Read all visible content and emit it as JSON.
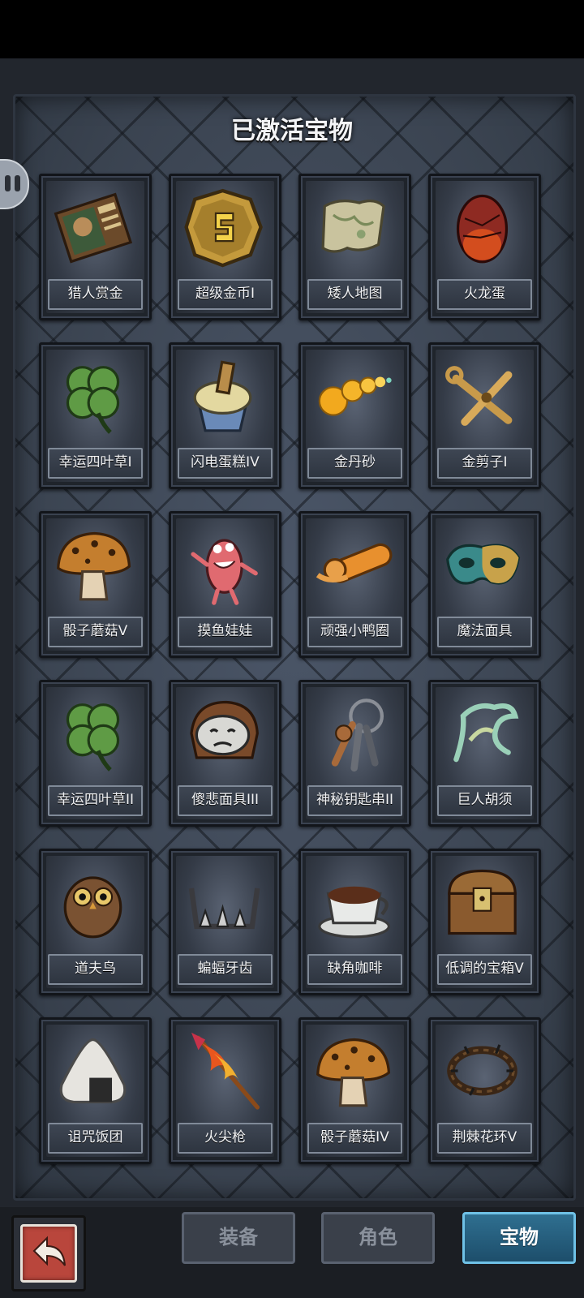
{
  "title": "已激活宝物",
  "items": [
    {
      "label": "猎人赏金",
      "icon": "bounty-poster-icon"
    },
    {
      "label": "超级金币I",
      "icon": "gold-coin-icon"
    },
    {
      "label": "矮人地图",
      "icon": "map-scroll-icon"
    },
    {
      "label": "火龙蛋",
      "icon": "dragon-egg-icon"
    },
    {
      "label": "幸运四叶草I",
      "icon": "four-leaf-clover-icon"
    },
    {
      "label": "闪电蛋糕IV",
      "icon": "cupcake-icon"
    },
    {
      "label": "金丹砂",
      "icon": "golden-beads-icon"
    },
    {
      "label": "金剪子I",
      "icon": "scissors-icon"
    },
    {
      "label": "骰子蘑菇V",
      "icon": "dice-mushroom-icon"
    },
    {
      "label": "摸鱼娃娃",
      "icon": "pink-doll-icon"
    },
    {
      "label": "顽强小鸭圈",
      "icon": "swim-ring-icon"
    },
    {
      "label": "魔法面具",
      "icon": "magic-mask-icon"
    },
    {
      "label": "幸运四叶草II",
      "icon": "four-leaf-clover-icon"
    },
    {
      "label": "傻悲面具III",
      "icon": "sad-mask-icon"
    },
    {
      "label": "神秘钥匙串II",
      "icon": "keyring-icon"
    },
    {
      "label": "巨人胡须",
      "icon": "beard-icon"
    },
    {
      "label": "道夫鸟",
      "icon": "owl-icon"
    },
    {
      "label": "蝙蝠牙齿",
      "icon": "bat-teeth-icon"
    },
    {
      "label": "缺角咖啡",
      "icon": "broken-coffee-cup-icon"
    },
    {
      "label": "低调的宝箱V",
      "icon": "treasure-chest-icon"
    },
    {
      "label": "诅咒饭团",
      "icon": "rice-ball-icon"
    },
    {
      "label": "火尖枪",
      "icon": "fire-spear-icon"
    },
    {
      "label": "骰子蘑菇IV",
      "icon": "dice-mushroom-icon"
    },
    {
      "label": "荆棘花环V",
      "icon": "thorn-wreath-icon"
    }
  ],
  "tabs": [
    {
      "label": "装备",
      "active": false
    },
    {
      "label": "角色",
      "active": false
    },
    {
      "label": "宝物",
      "active": true
    }
  ],
  "colors": {
    "panel": "#3b4452",
    "active_tab": "#2f6f90",
    "back_button": "#b9463c"
  }
}
